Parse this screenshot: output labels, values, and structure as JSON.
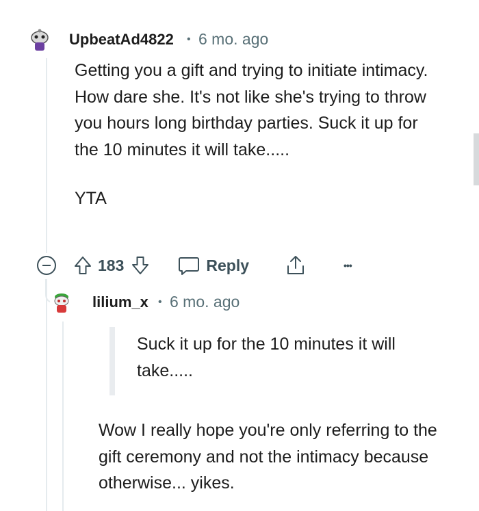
{
  "comment": {
    "username": "UpbeatAd4822",
    "time": "6 mo. ago",
    "separator": "•",
    "paragraphs": [
      "Getting you a gift and trying to initiate intimacy. How dare she. It's not like she's trying to throw you hours long birthday parties. Suck it up for the 10 minutes it will take.....",
      "YTA"
    ],
    "votes": "183",
    "reply_label": "Reply",
    "more_label": "•••"
  },
  "reply": {
    "username": "lilium_x",
    "time": "6 mo. ago",
    "separator": "•",
    "quote": "Suck it up for the 10 minutes it will take.....",
    "text": "Wow I really hope you're only referring to the gift ceremony and not the intimacy because otherwise... yikes."
  },
  "colors": {
    "text": "#1c1c1c",
    "meta": "#576f76",
    "action": "#3c5059",
    "thread_line": "#e5ebee"
  }
}
